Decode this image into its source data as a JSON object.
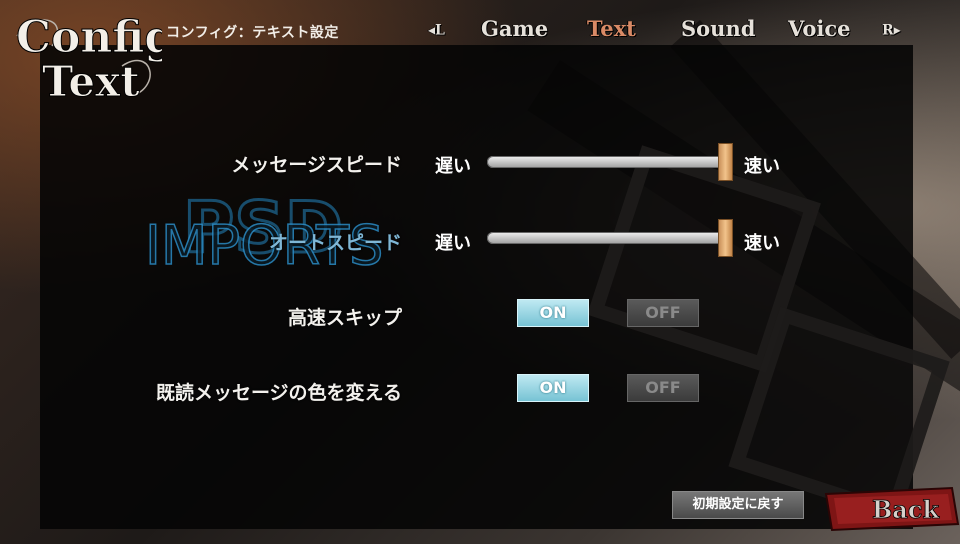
{
  "header": {
    "logo_line1": "Config",
    "logo_line2": "Text",
    "subtitle": "コンフィグ：テキスト設定"
  },
  "tabs": {
    "prev": "◂L",
    "items": [
      {
        "label": "Game",
        "active": false
      },
      {
        "label": "Text",
        "active": true
      },
      {
        "label": "Sound",
        "active": false
      },
      {
        "label": "Voice",
        "active": false
      }
    ],
    "next": "R▸"
  },
  "settings": {
    "message_speed": {
      "label": "メッセージスピード",
      "min_label": "遅い",
      "max_label": "速い",
      "value": 1.0
    },
    "auto_speed": {
      "label": "オートスピード",
      "min_label": "遅い",
      "max_label": "速い",
      "value": 1.0
    },
    "skip": {
      "label": "高速スキップ",
      "on_label": "ON",
      "off_label": "OFF",
      "selected": "ON"
    },
    "read_color": {
      "label": "既読メッセージの色を変える",
      "on_label": "ON",
      "off_label": "OFF",
      "selected": "ON"
    }
  },
  "footer": {
    "reset_label": "初期設定に戻す",
    "back_label": "Back"
  },
  "watermark": {
    "text": "IMPORTS",
    "monogram": "PSD"
  },
  "colors": {
    "active_tab": "#d98a66",
    "on_button": "#8fd3e0",
    "back_button": "#8b1a1a"
  }
}
